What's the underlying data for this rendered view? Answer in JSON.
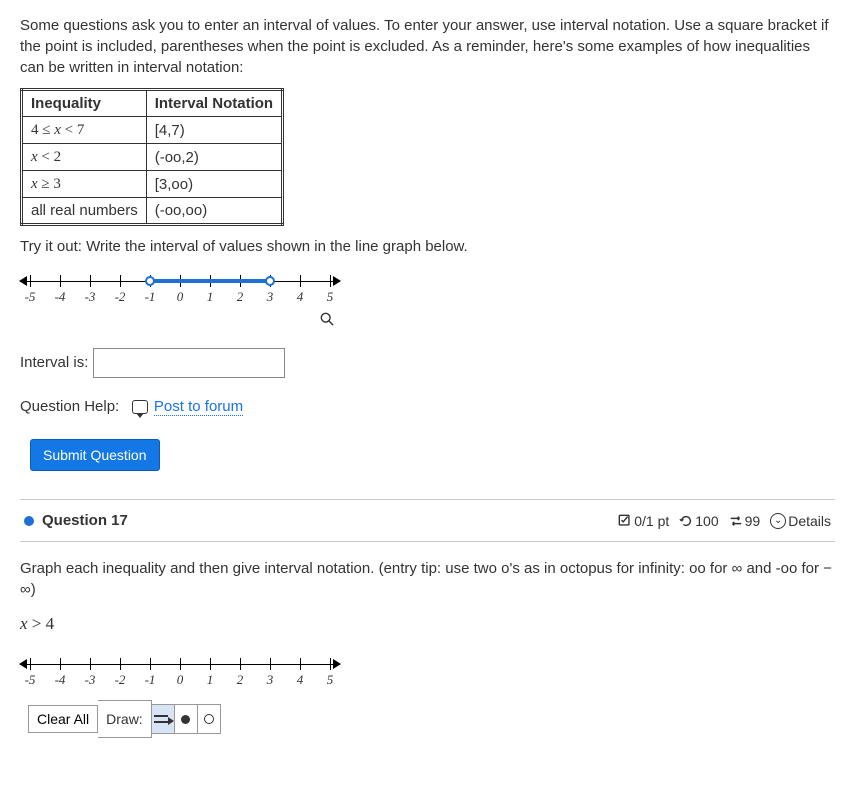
{
  "intro": "Some questions ask you to enter an interval of values. To enter your answer, use interval notation. Use a square bracket if the point is included, parentheses when the point is excluded. As a reminder, here's some examples of how inequalities can be written in interval notation:",
  "table": {
    "headers": [
      "Inequality",
      "Interval Notation"
    ],
    "rows": [
      {
        "ineq": "4 ≤ x < 7",
        "notation": "[4,7)"
      },
      {
        "ineq": "x < 2",
        "notation": "(-oo,2)"
      },
      {
        "ineq": "x ≥ 3",
        "notation": "[3,oo)"
      },
      {
        "ineq": "all real numbers",
        "notation": "(-oo,oo)"
      }
    ]
  },
  "tryit": "Try it out: Write the interval of values shown in the line graph below.",
  "numberline1": {
    "ticks": [
      "-5",
      "-4",
      "-3",
      "-2",
      "-1",
      "0",
      "1",
      "2",
      "3",
      "4",
      "5"
    ],
    "interval_from": -1,
    "interval_to": 3,
    "left_open": true,
    "right_open": true
  },
  "interval_label": "Interval is:",
  "interval_value": "",
  "help_label": "Question Help:",
  "forum_label": " Post to forum",
  "submit_label": "Submit Question",
  "q17": {
    "title": "Question 17",
    "score": "0/1 pt",
    "retries": "100",
    "attempts": "99",
    "details": "Details",
    "body": "Graph each inequality and then give interval notation. (entry tip: use two o's as in octopus for infinity: oo for ∞ and -oo for − ∞)",
    "inequality": "x > 4"
  },
  "numberline2": {
    "ticks": [
      "-5",
      "-4",
      "-3",
      "-2",
      "-1",
      "0",
      "1",
      "2",
      "3",
      "4",
      "5"
    ]
  },
  "toolbar": {
    "clear": "Clear All",
    "draw": "Draw:"
  }
}
